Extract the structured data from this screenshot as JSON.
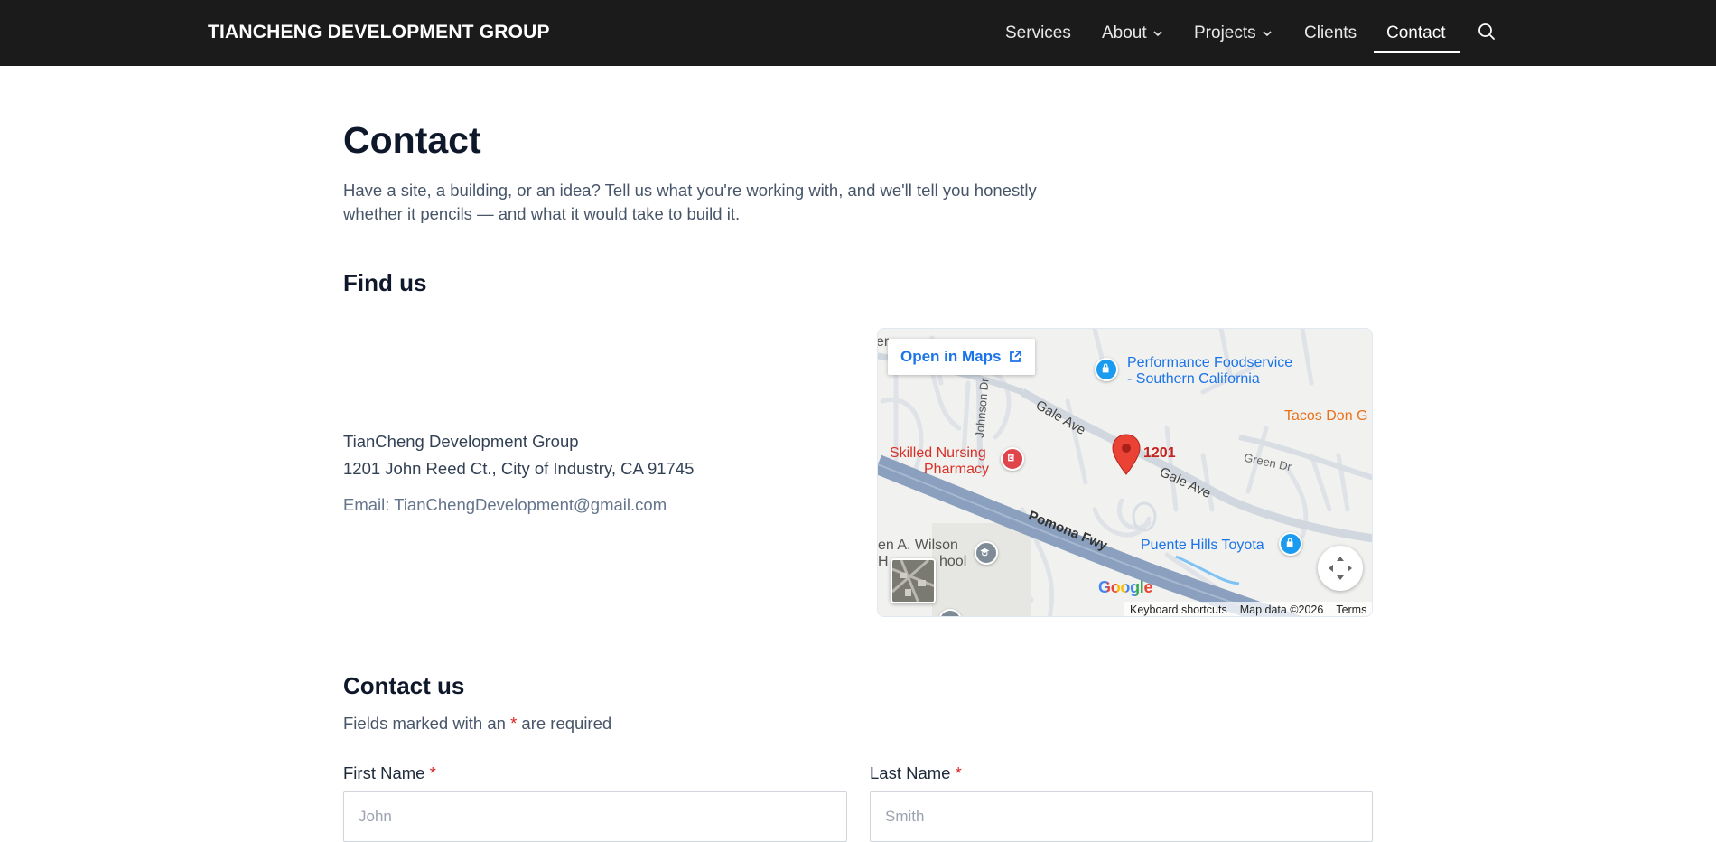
{
  "header": {
    "brand": "TIANCHENG DEVELOPMENT GROUP",
    "nav": {
      "services": "Services",
      "about": "About",
      "projects": "Projects",
      "clients": "Clients",
      "contact": "Contact"
    },
    "search_icon": "search-icon"
  },
  "main": {
    "title": "Contact",
    "intro_line1": "Have a site, a building, or an idea? Tell us what you're working with, and we'll tell you honestly",
    "intro_line2": "whether it pencils — and what it would take to build it.",
    "find_us": {
      "heading": "Find us",
      "company": "TianCheng Development Group",
      "address": "1201 John Reed Ct., City of Industry, CA 91745",
      "email": "Email: TianChengDevelopment@gmail.com"
    },
    "map": {
      "open_in_maps": "Open in Maps",
      "labels": {
        "performance1": "Performance Foodservice",
        "performance2": "- Southern California",
        "tacos": "Tacos Don G",
        "gale1": "Gale Ave",
        "gale2": "Gale Ave",
        "johnson": "Johnson Dr",
        "green": "Green Dr",
        "pin": "1201",
        "pharmacy1": "Skilled Nursing",
        "pharmacy2": "Pharmacy",
        "freeway": "Pomona Fwy",
        "toyota": "Puente Hills Toyota",
        "school1": "en A. Wilson",
        "school2": "H",
        "school3": "hool",
        "edge": "er"
      },
      "google": "Google",
      "attribution": {
        "shortcuts": "Keyboard shortcuts",
        "map_data": "Map data ©2026",
        "terms": "Terms"
      },
      "colors": {
        "pin": "#ea4335",
        "poi_blue": "#1a9bf0",
        "poi_red": "#e0454b",
        "poi_gray": "#7e8b96",
        "freeway": "#8aa0be",
        "link": "#1a73e8"
      }
    },
    "contact_us": {
      "heading": "Contact us",
      "note_before": "Fields marked with an",
      "note_star": "*",
      "note_after": "are required",
      "first_name": {
        "label": "First Name",
        "star": "*",
        "placeholder": "John"
      },
      "last_name": {
        "label": "Last Name",
        "star": "*",
        "placeholder": "Smith"
      }
    }
  }
}
